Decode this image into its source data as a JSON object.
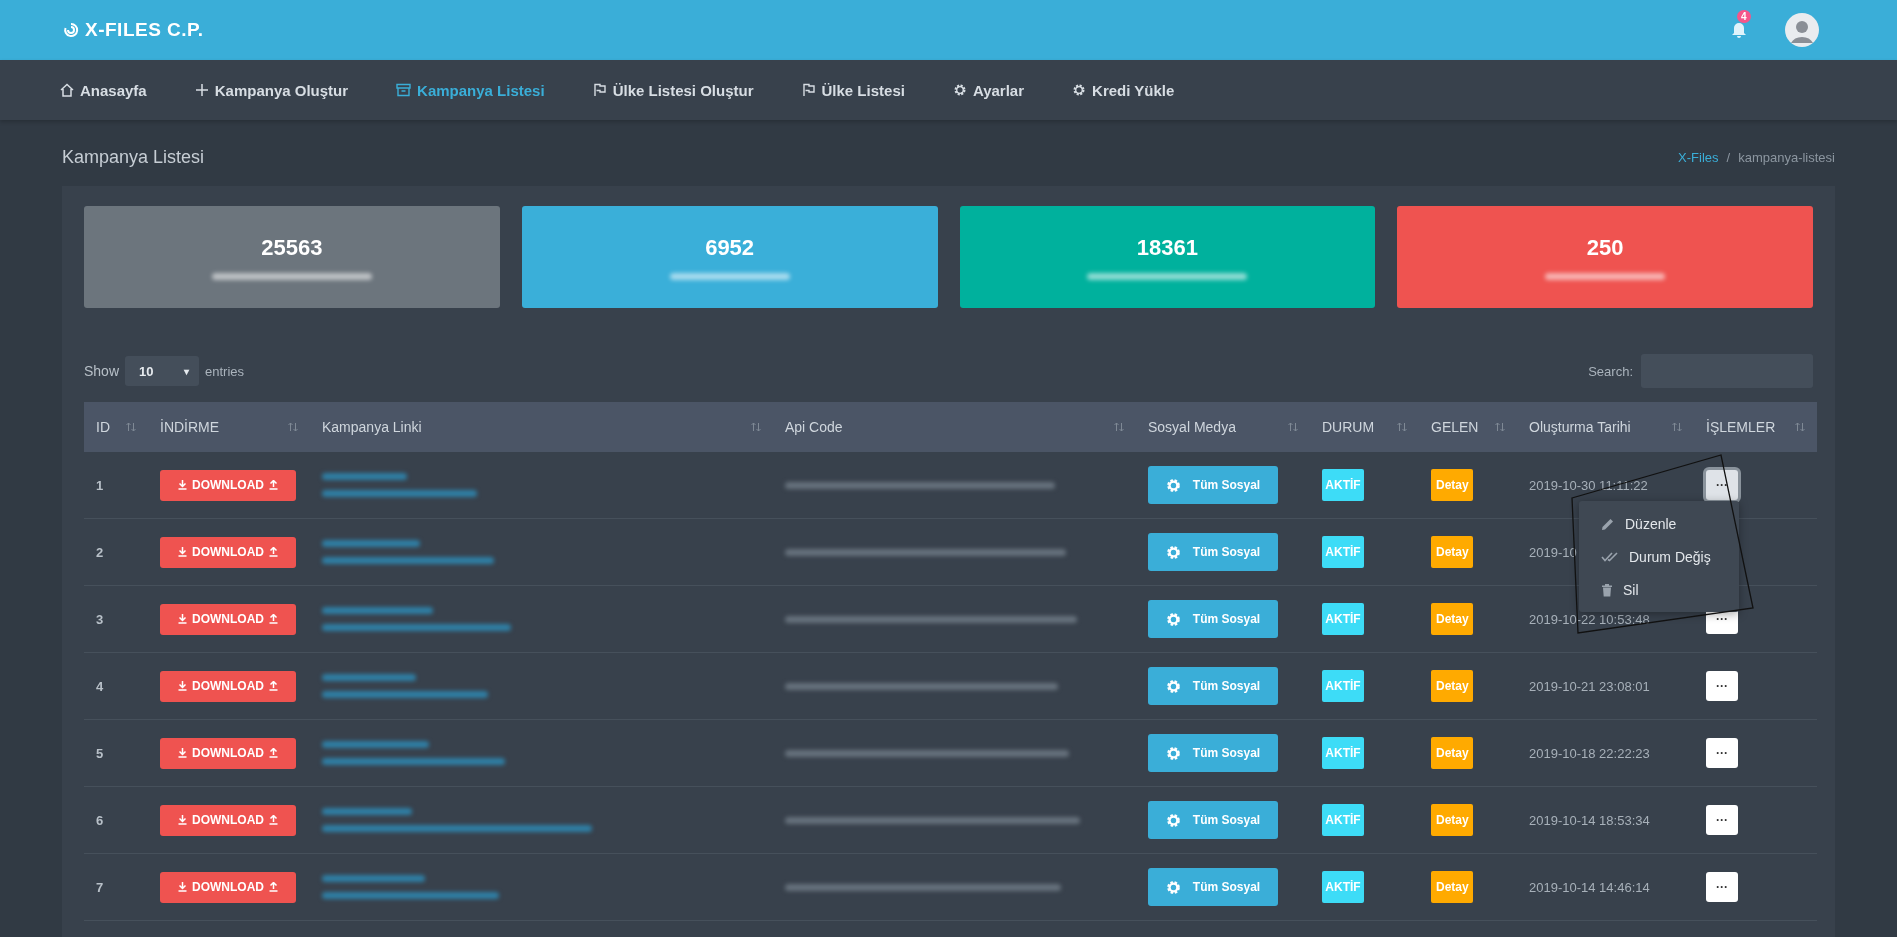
{
  "header": {
    "brand": "X-FILES C.P.",
    "notification_count": "4"
  },
  "nav": [
    {
      "label": "Anasayfa",
      "selected": false
    },
    {
      "label": "Kampanya Oluştur",
      "selected": false
    },
    {
      "label": "Kampanya Listesi",
      "selected": true
    },
    {
      "label": "Ülke Listesi Oluştur",
      "selected": false
    },
    {
      "label": "Ülke Listesi",
      "selected": false
    },
    {
      "label": "Ayarlar",
      "selected": false
    },
    {
      "label": "Kredi Yükle",
      "selected": false
    }
  ],
  "page_title": "Kampanya Listesi",
  "breadcrumb_separator": "/",
  "breadcrumb": [
    {
      "label": "X-Files",
      "kind": "link"
    },
    {
      "label": "kampanya-listesi",
      "kind": "current"
    }
  ],
  "stats": [
    {
      "value": "25563",
      "color": "#6c757d"
    },
    {
      "value": "6952",
      "color": "#3aafd9"
    },
    {
      "value": "18361",
      "color": "#00b19d"
    },
    {
      "value": "250",
      "color": "#ef5350"
    }
  ],
  "table_controls": {
    "show_label": "Show",
    "page_size": "10",
    "page_size_caret": "▾",
    "entries_label": "entries",
    "search_label": "Search:"
  },
  "columns": [
    "ID",
    "İNDİRME",
    "Kampanya Linki",
    "Api Code",
    "Sosyal Medya",
    "DURUM",
    "GELEN",
    "Oluşturma Tarihi",
    "İŞLEMLER"
  ],
  "rows": [
    {
      "id": "1",
      "download": "DOWNLOAD",
      "social": "Tüm Sosyal",
      "status": "AKTİF",
      "incoming": "Detay",
      "created": "2019-10-30 11:11:22",
      "more": "···",
      "menu_open": true
    },
    {
      "id": "2",
      "download": "DOWNLOAD",
      "social": "Tüm Sosyal",
      "status": "AKTİF",
      "incoming": "Detay",
      "created": "2019-10",
      "menu_open": false
    },
    {
      "id": "3",
      "download": "DOWNLOAD",
      "social": "Tüm Sosyal",
      "status": "AKTİF",
      "incoming": "Detay",
      "created": "2019-10-22 10:53:48",
      "more": "···",
      "menu_open": false
    },
    {
      "id": "4",
      "download": "DOWNLOAD",
      "social": "Tüm Sosyal",
      "status": "AKTİF",
      "incoming": "Detay",
      "created": "2019-10-21 23:08:01",
      "more": "···",
      "menu_open": false
    },
    {
      "id": "5",
      "download": "DOWNLOAD",
      "social": "Tüm Sosyal",
      "status": "AKTİF",
      "incoming": "Detay",
      "created": "2019-10-18 22:22:23",
      "more": "···",
      "menu_open": false
    },
    {
      "id": "6",
      "download": "DOWNLOAD",
      "social": "Tüm Sosyal",
      "status": "AKTİF",
      "incoming": "Detay",
      "created": "2019-10-14 18:53:34",
      "more": "···",
      "menu_open": false
    },
    {
      "id": "7",
      "download": "DOWNLOAD",
      "social": "Tüm Sosyal",
      "status": "AKTİF",
      "incoming": "Detay",
      "created": "2019-10-14 14:46:14",
      "more": "···",
      "menu_open": false
    }
  ],
  "actions_menu": [
    {
      "label": "Düzenle"
    },
    {
      "label": "Durum Değiş"
    },
    {
      "label": "Sil"
    }
  ]
}
